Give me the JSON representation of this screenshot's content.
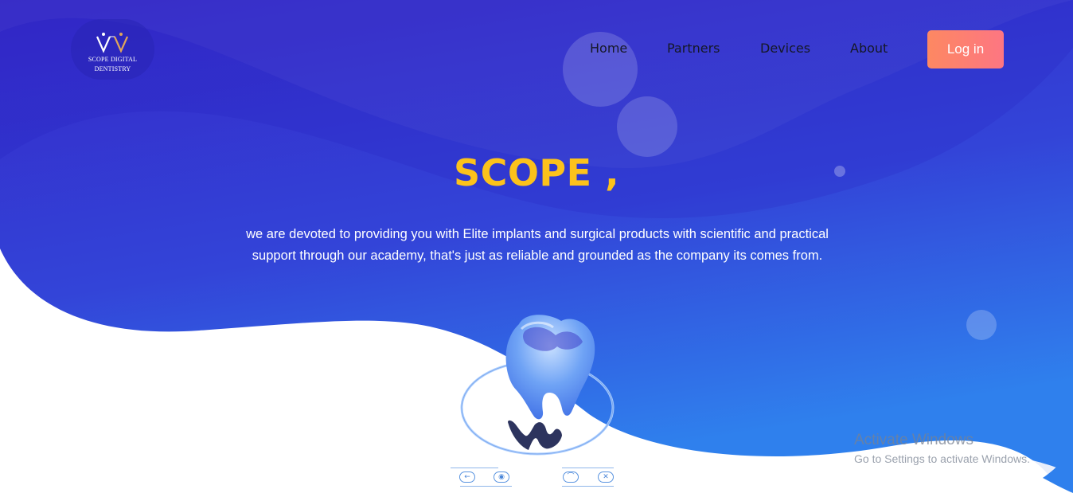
{
  "brand": {
    "logo_name": "logo-mark",
    "logo_line1": "SCOPE DIGITAL",
    "logo_line2": "DENTISTRY"
  },
  "nav": {
    "items": [
      "Home",
      "Partners",
      "Devices",
      "About"
    ]
  },
  "auth": {
    "login_label": "Log in"
  },
  "hero": {
    "title": "SCOPE ,",
    "description_line1": "we are devoted to providing you with Elite implants and surgical products with scientific and practical",
    "description_line2": "support through our academy, that's just as reliable and grounded as the company its comes from."
  },
  "viewer_controls": [
    {
      "icon": "arrow-left-icon",
      "glyph": "←"
    },
    {
      "icon": "eye-icon",
      "glyph": "◉"
    },
    {
      "icon": "rotate-icon",
      "glyph": "⌒"
    },
    {
      "icon": "close-icon",
      "glyph": "✕"
    }
  ],
  "watermark": {
    "title": "Activate Windows",
    "subtitle": "Go to Settings to activate Windows."
  },
  "colors": {
    "hero_top": "#3428c8",
    "hero_bottom": "#2f80ed",
    "title": "#fcc21b",
    "login_gradient_start": "#fd8862",
    "login_gradient_end": "#fd7682",
    "nav_text": "#151826"
  }
}
